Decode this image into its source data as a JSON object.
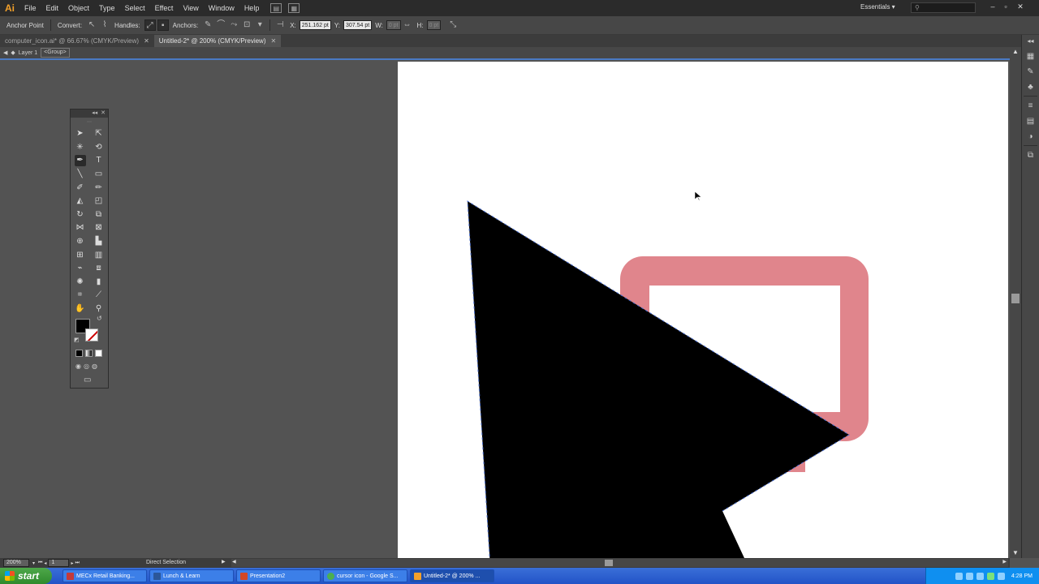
{
  "app": {
    "logo": "Ai"
  },
  "menu": [
    "File",
    "Edit",
    "Object",
    "Type",
    "Select",
    "Effect",
    "View",
    "Window",
    "Help"
  ],
  "workspace": {
    "label": "Essentials ▾",
    "search_placeholder": ""
  },
  "control_bar": {
    "tool_name": "Anchor Point",
    "convert_label": "Convert:",
    "handles_label": "Handles:",
    "anchors_label": "Anchors:",
    "x_label": "X:",
    "x_value": "251.162 pt",
    "y_label": "Y:",
    "y_value": "307.54 pt",
    "w_label": "W:",
    "w_value": "0 pt",
    "h_label": "H:",
    "h_value": "0 pt"
  },
  "doc_tabs": [
    {
      "label": "computer_icon.ai* @ 66.67% (CMYK/Preview)",
      "active": false
    },
    {
      "label": "Untitled-2* @ 200% (CMYK/Preview)",
      "active": true
    }
  ],
  "breadcrumb": {
    "layer": "Layer 1",
    "group": "<Group>"
  },
  "status_bar": {
    "zoom": "200%",
    "artboard": "1",
    "tool": "Direct Selection"
  },
  "taskbar": {
    "start_label": "start",
    "items": [
      {
        "label": "MECx Retail Banking...",
        "color": "#c43a3a",
        "active": false
      },
      {
        "label": "Lunch & Learn",
        "color": "#2b579a",
        "active": false
      },
      {
        "label": "Presentation2",
        "color": "#d24726",
        "active": false
      },
      {
        "label": "cursor icon - Google S...",
        "color": "#4caf50",
        "active": false
      },
      {
        "label": "Untitled-2* @ 200% ...",
        "color": "#f3a02a",
        "active": true
      }
    ],
    "clock": "4:28 PM"
  },
  "artwork": {
    "arrow_fill": "#000000",
    "frame_color": "#e0858c",
    "selection_color": "#4a6fd0"
  }
}
